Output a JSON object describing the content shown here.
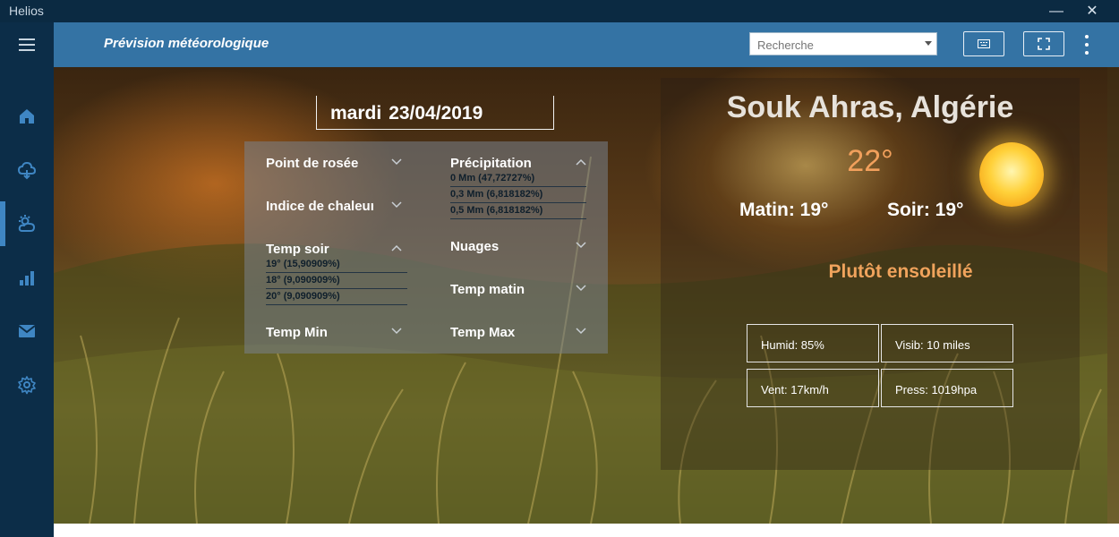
{
  "window": {
    "app_name": "Helios",
    "minimize_glyph": "—",
    "close_glyph": "✕"
  },
  "header": {
    "title": "Prévision météorologique",
    "search_placeholder": "Recherche"
  },
  "sidebar": {
    "items": [
      {
        "icon": "menu-icon"
      },
      {
        "icon": "home-icon"
      },
      {
        "icon": "cloud-icon"
      },
      {
        "icon": "weather-icon",
        "active": true
      },
      {
        "icon": "chart-icon"
      },
      {
        "icon": "mail-icon"
      },
      {
        "icon": "gear-icon"
      }
    ]
  },
  "date": {
    "day": "mardi",
    "value": "23/04/2019"
  },
  "details": {
    "point_rosee": "Point de rosée",
    "indice_chaleur": "Indice de chaleur",
    "temp_soir": {
      "label": "Temp soir",
      "items": [
        "19° (15,90909%)",
        "18° (9,090909%)",
        "20° (9,090909%)"
      ]
    },
    "temp_min": "Temp Min",
    "precipitation": {
      "label": "Précipitation",
      "items": [
        "0 Mm (47,72727%)",
        "0,3 Mm (6,818182%)",
        "0,5 Mm (6,818182%)"
      ]
    },
    "nuages": "Nuages",
    "temp_matin": "Temp matin",
    "temp_max": "Temp Max"
  },
  "weather": {
    "city": "Souk Ahras, Algérie",
    "temperature": "22°",
    "morning": "Matin: 19°",
    "evening": "Soir: 19°",
    "description": "Plutôt ensoleillé",
    "humidity": "Humid: 85%",
    "visibility": "Visib: 10 miles",
    "wind": "Vent: 17km/h",
    "pressure": "Press: 1019hpa"
  },
  "colors": {
    "header": "#3473a4",
    "sidebar": "#0c2d48",
    "accent_text": "#f0a35c",
    "active_indicator": "#3f86c3"
  }
}
